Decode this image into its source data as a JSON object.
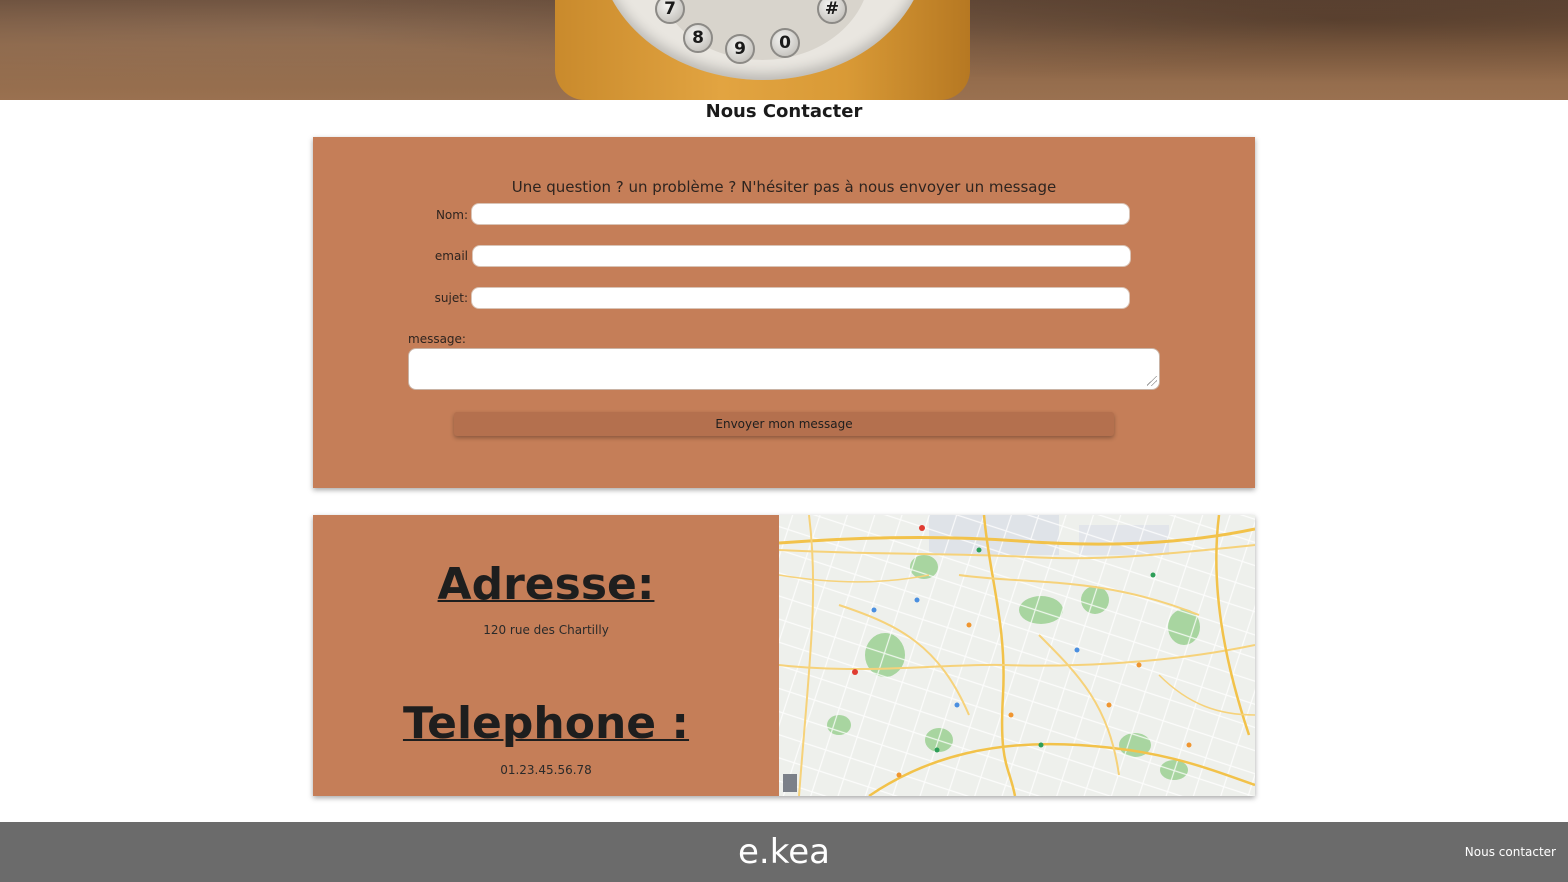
{
  "page": {
    "title": "Nous Contacter"
  },
  "hero": {
    "dial_keys": [
      "7",
      "8",
      "9",
      "0",
      "#"
    ]
  },
  "contact_form": {
    "intro": "Une question ? un problème ? N'hésiter pas à nous envoyer un message",
    "name_label": "Nom:",
    "name_value": "",
    "email_label": "email",
    "email_value": "",
    "subject_label": "sujet:",
    "subject_value": "",
    "message_label": "message:",
    "message_value": "",
    "submit_label": "Envoyer mon message"
  },
  "info": {
    "address_heading": "Adresse:",
    "address_value": "120 rue des Chartilly",
    "phone_heading": "Telephone :",
    "phone_value": "01.23.45.56.78"
  },
  "footer": {
    "logo": "e.kea",
    "contact_link": "Nous contacter"
  },
  "colors": {
    "card_background": "#c57e58",
    "button_background": "#b4704e",
    "footer_background": "#6b6b6b"
  }
}
